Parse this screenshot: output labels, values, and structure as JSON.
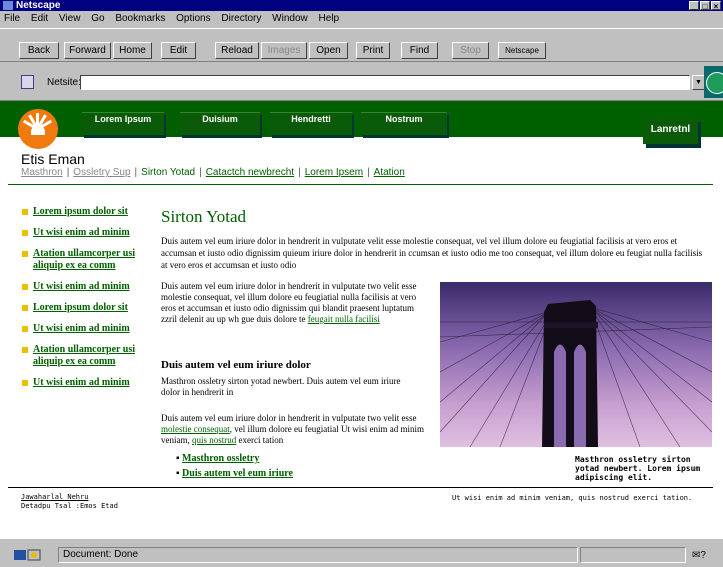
{
  "window": {
    "title": "Netscape",
    "controls": [
      "minimize-icon",
      "maximize-icon",
      "close-icon"
    ]
  },
  "menu": [
    "File",
    "Edit",
    "View",
    "Go",
    "Bookmarks",
    "Options",
    "Directory",
    "Window",
    "Help"
  ],
  "toolbar": {
    "buttons": [
      "Back",
      "Forward",
      "Home",
      "Edit",
      "Reload",
      "Images",
      "Open",
      "Print",
      "Find",
      "Stop",
      "Netscape"
    ],
    "disabled": [
      "Images",
      "Stop"
    ]
  },
  "location": {
    "label": "Netsite:",
    "value": ""
  },
  "site": {
    "nav": [
      "Lorem Ipsum",
      "Duisium",
      "Hendretti",
      "Nostrum"
    ],
    "nav_right": "Lanretnl",
    "name": "Etis Eman",
    "breadcrumb": [
      "Masthron",
      "Ossletry Sup",
      "Sirton Yotad",
      "Catactch newbrecht",
      "Lorem Ipsem",
      "Atation"
    ],
    "colors": {
      "green": "#006000",
      "bullet": "#e8c000",
      "logo": "#f07a10"
    }
  },
  "sidenav": [
    "Lorem ipsum dolor sit",
    "Ut wisi enim ad minim",
    "Atation ullamcorper usi aliquip ex ea comm",
    "Ut wisi enim ad minim",
    "Lorem ipsum dolor sit",
    "Ut wisi enim ad minim",
    "Atation ullamcorper usi aliquip ex ea comm",
    "Ut wisi enim ad minim"
  ],
  "article": {
    "title": "Sirton Yotad",
    "para1": "Duis autem vel eum iriure dolor in hendrerit in vulputate velit esse molestie consequat, vel vel illum dolore eu feugiatial facilisis at vero eros et accumsan et iusto odio dignissim quieum iriure dolor in hendrerit in ccumsan et iusto odio me too consequat, vel illum dolore eu feugiat nulla facilisis at vero eros et accumsan et iusto odio",
    "para2": "Duis autem vel eum iriure dolor in hendrerit in vulputate two velit esse molestie consequat, vel illum dolore eu feugiatial nulla facilisis at vero eros et accumsan et iusto odio dignissim qui blandit praesent luptatum zzril delenit au up wh gue duis dolore te",
    "para2_link": "feugait nulla facilisi",
    "heading2": "Duis autem vel eum iriure dolor",
    "para2b": "Masthron ossletry sirton yotad newbert. Duis autem vel eum iriure dolor in hendrerit in",
    "para3_a": "Duis autem vel eum iriure dolor in hendrerit in vulputate two velit esse",
    "para3_link1": "molestie consequat",
    "para3_b": ", vel illum dolore eu feugiatial Ut wisi enim ad minim veniam,",
    "para3_link2": "quis nostrud",
    "para3_c": "exerci tation",
    "bullets": [
      "Masthron ossletry",
      "Duis autem vel eum iriure"
    ],
    "caption": "Masthron ossletry sirton yotad newbert. Lorem ipsum adipiscing elit."
  },
  "footer": {
    "left_line1": "Jawaharlal Nehru",
    "left_line2": "Detadpu Tsal :Emos Etad",
    "right": "Ut wisi enim ad minim veniam, quis nostrud exerci tation."
  },
  "status": {
    "text": "Document: Done"
  }
}
